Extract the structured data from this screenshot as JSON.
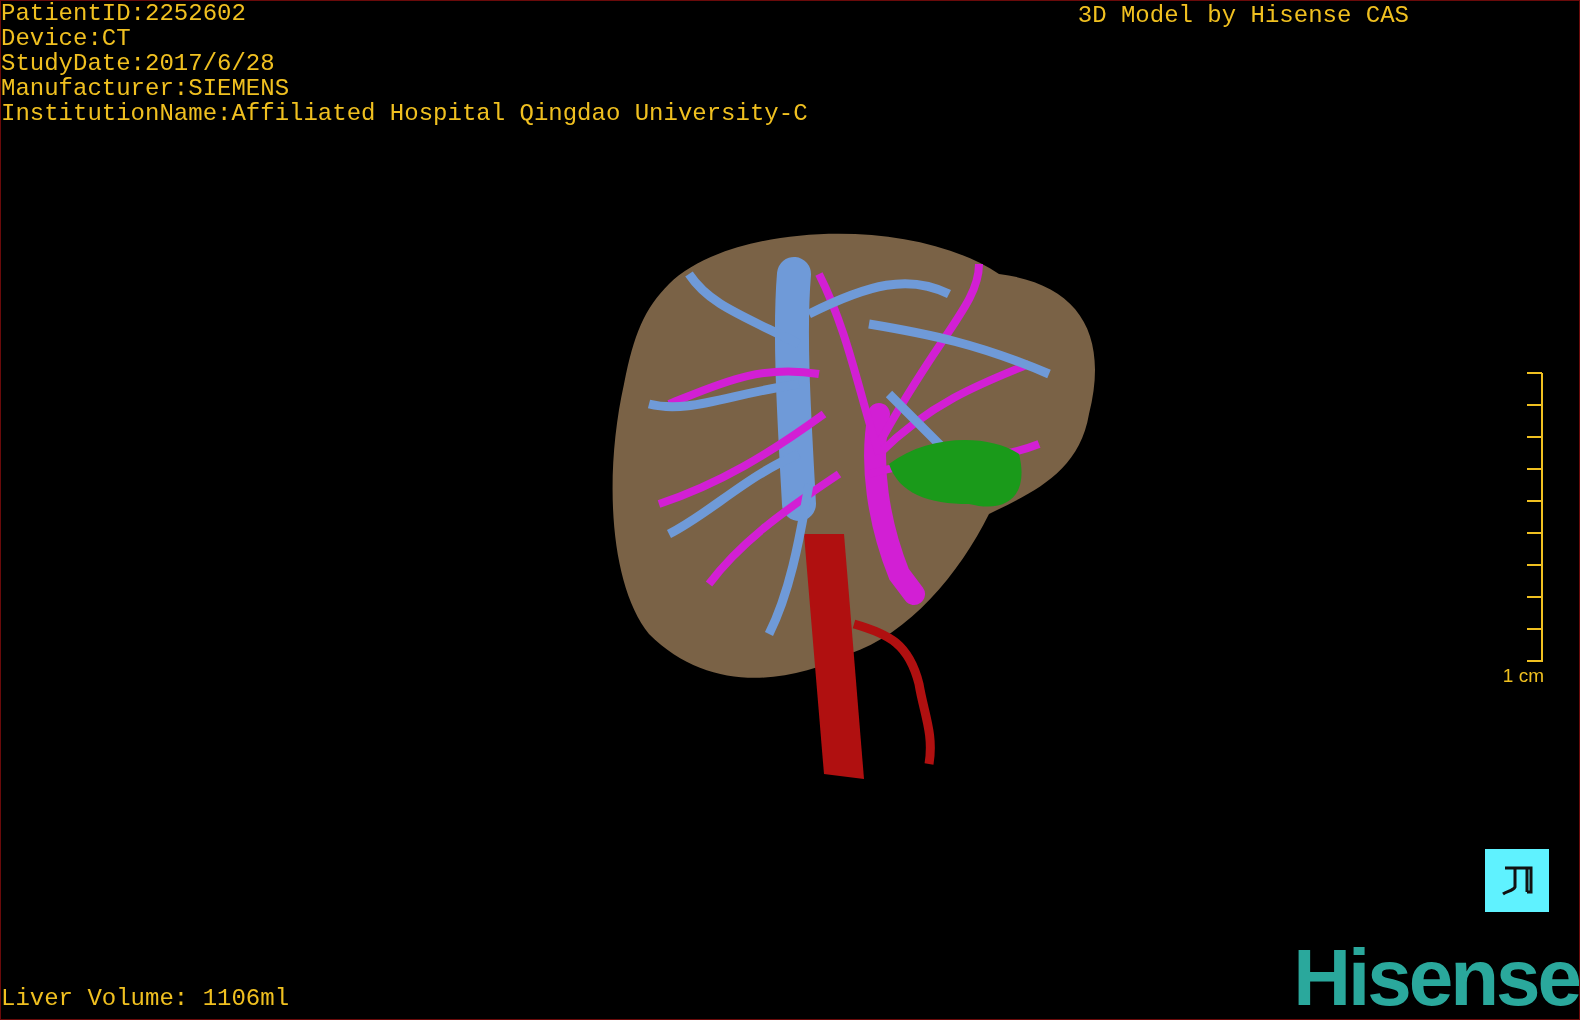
{
  "info_lines": [
    "PatientID:2252602",
    "Device:CT",
    "StudyDate:2017/6/28",
    "Manufacturer:SIEMENS",
    "InstitutionName:Affiliated Hospital Qingdao University-C"
  ],
  "title": "3D Model by Hisense CAS",
  "scale_bar": {
    "label": "1 cm"
  },
  "liver_volume": "Liver Volume: 1106ml",
  "logo": "Hisense"
}
